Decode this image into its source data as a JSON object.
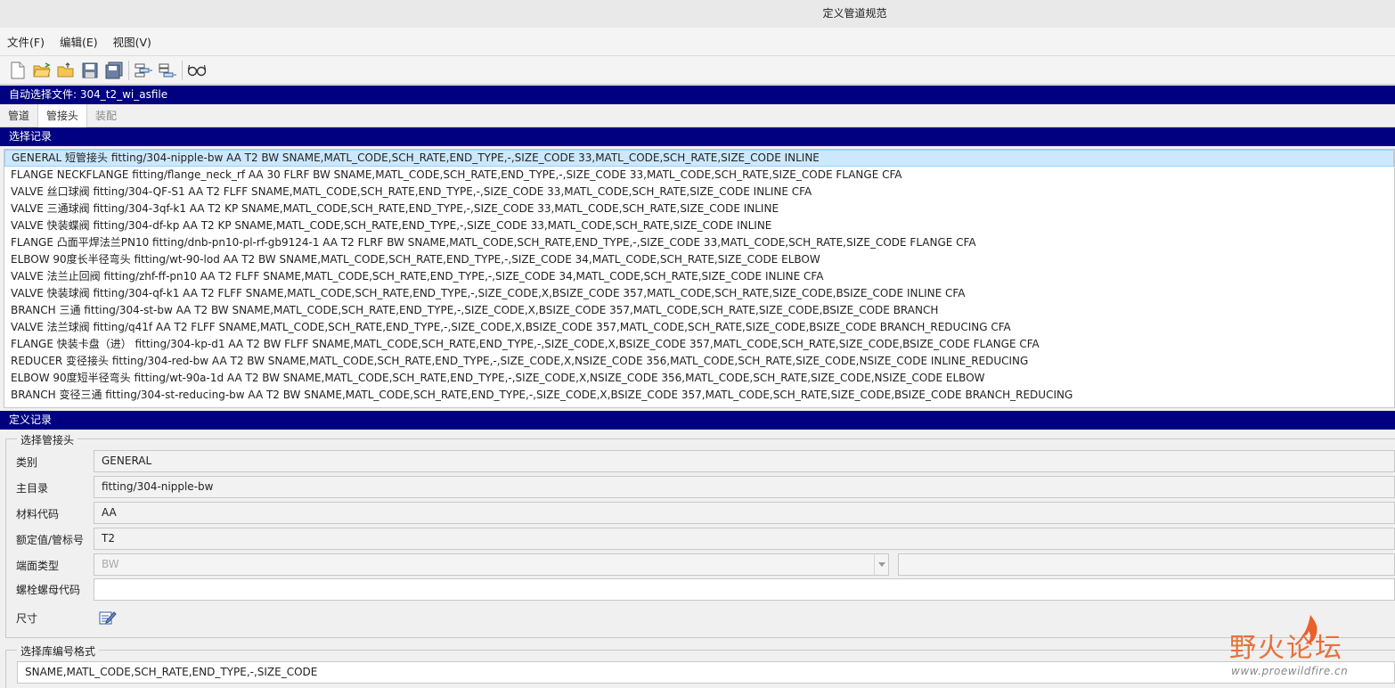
{
  "window": {
    "title": "定义管道规范"
  },
  "menu": [
    {
      "label": "文件(F)"
    },
    {
      "label": "编辑(E)"
    },
    {
      "label": "视图(V)"
    }
  ],
  "toolbar": {
    "buttons": [
      "new-file-icon",
      "open-folder-icon",
      "open-icon",
      "save-icon",
      "save-as-icon",
      "insert-row-icon",
      "append-row-icon",
      "preview-glasses-icon"
    ]
  },
  "auto_file": "自动选择文件: 304_t2_wi_asfile",
  "tabs": [
    {
      "label": "管道"
    },
    {
      "label": "管接头"
    },
    {
      "label": "装配"
    }
  ],
  "select_records": {
    "header": "选择记录",
    "rows": [
      "GENERAL 短管接头 fitting/304-nipple-bw AA T2 BW  SNAME,MATL_CODE,SCH_RATE,END_TYPE,-,SIZE_CODE 33,MATL_CODE,SCH_RATE,SIZE_CODE INLINE",
      "FLANGE NECKFLANGE fitting/flange_neck_rf AA 30 FLRF BW SNAME,MATL_CODE,SCH_RATE,END_TYPE,-,SIZE_CODE 33,MATL_CODE,SCH_RATE,SIZE_CODE FLANGE   CFA",
      "VALVE 丝口球阀 fitting/304-QF-S1 AA T2 FLFF  SNAME,MATL_CODE,SCH_RATE,END_TYPE,-,SIZE_CODE 33,MATL_CODE,SCH_RATE,SIZE_CODE INLINE   CFA",
      "VALVE 三通球阀 fitting/304-3qf-k1 AA T2 KP  SNAME,MATL_CODE,SCH_RATE,END_TYPE,-,SIZE_CODE 33,MATL_CODE,SCH_RATE,SIZE_CODE INLINE",
      "VALVE 快装蝶阀 fitting/304-df-kp AA T2 KP  SNAME,MATL_CODE,SCH_RATE,END_TYPE,-,SIZE_CODE 33,MATL_CODE,SCH_RATE,SIZE_CODE INLINE",
      "FLANGE 凸面平焊法兰PN10 fitting/dnb-pn10-pl-rf-gb9124-1 AA T2 FLRF BW SNAME,MATL_CODE,SCH_RATE,END_TYPE,-,SIZE_CODE 33,MATL_CODE,SCH_RATE,SIZE_CODE FLANGE   CFA",
      "ELBOW 90度长半径弯头 fitting/wt-90-lod AA T2 BW  SNAME,MATL_CODE,SCH_RATE,END_TYPE,-,SIZE_CODE 34,MATL_CODE,SCH_RATE,SIZE_CODE ELBOW",
      "VALVE 法兰止回阀 fitting/zhf-ff-pn10 AA T2 FLFF  SNAME,MATL_CODE,SCH_RATE,END_TYPE,-,SIZE_CODE 34,MATL_CODE,SCH_RATE,SIZE_CODE INLINE   CFA",
      "VALVE 快装球阀 fitting/304-qf-k1 AA T2 FLFF  SNAME,MATL_CODE,SCH_RATE,END_TYPE,-,SIZE_CODE,X,BSIZE_CODE 357,MATL_CODE,SCH_RATE,SIZE_CODE,BSIZE_CODE INLINE   CFA",
      "BRANCH 三通 fitting/304-st-bw AA T2 BW  SNAME,MATL_CODE,SCH_RATE,END_TYPE,-,SIZE_CODE,X,BSIZE_CODE 357,MATL_CODE,SCH_RATE,SIZE_CODE,BSIZE_CODE BRANCH",
      "VALVE 法兰球阀 fitting/q41f AA T2 FLFF  SNAME,MATL_CODE,SCH_RATE,END_TYPE,-,SIZE_CODE,X,BSIZE_CODE 357,MATL_CODE,SCH_RATE,SIZE_CODE,BSIZE_CODE BRANCH_REDUCING   CFA",
      "FLANGE 快装卡盘（进） fitting/304-kp-d1 AA T2 BW FLFF SNAME,MATL_CODE,SCH_RATE,END_TYPE,-,SIZE_CODE,X,BSIZE_CODE 357,MATL_CODE,SCH_RATE,SIZE_CODE,BSIZE_CODE FLANGE   CFA",
      "REDUCER 变径接头 fitting/304-red-bw AA T2 BW  SNAME,MATL_CODE,SCH_RATE,END_TYPE,-,SIZE_CODE,X,NSIZE_CODE 356,MATL_CODE,SCH_RATE,SIZE_CODE,NSIZE_CODE INLINE_REDUCING",
      "ELBOW 90度短半径弯头 fitting/wt-90a-1d AA T2 BW  SNAME,MATL_CODE,SCH_RATE,END_TYPE,-,SIZE_CODE,X,NSIZE_CODE 356,MATL_CODE,SCH_RATE,SIZE_CODE,NSIZE_CODE ELBOW",
      "BRANCH 变径三通 fitting/304-st-reducing-bw AA T2 BW  SNAME,MATL_CODE,SCH_RATE,END_TYPE,-,SIZE_CODE,X,BSIZE_CODE 357,MATL_CODE,SCH_RATE,SIZE_CODE,BSIZE_CODE BRANCH_REDUCING"
    ]
  },
  "define_record": {
    "header": "定义记录",
    "group_title": "选择管接头",
    "fields": {
      "category": {
        "label": "类别",
        "value": "GENERAL"
      },
      "main_dir": {
        "label": "主目录",
        "value": "fitting/304-nipple-bw"
      },
      "material": {
        "label": "材料代码",
        "value": "AA"
      },
      "rating": {
        "label": "额定值/管标号",
        "value": "T2"
      },
      "end_type": {
        "label": "端面类型",
        "value": "BW",
        "value2": ""
      },
      "bolt_nut": {
        "label": "螺栓螺母代码",
        "value": ""
      },
      "size": {
        "label": "尺寸"
      }
    },
    "format_group_title": "选择库编号格式",
    "format_value": "SNAME,MATL_CODE,SCH_RATE,END_TYPE,-,SIZE_CODE"
  },
  "watermark": {
    "text": "野火论坛",
    "url": "www.proewildfire.cn"
  }
}
